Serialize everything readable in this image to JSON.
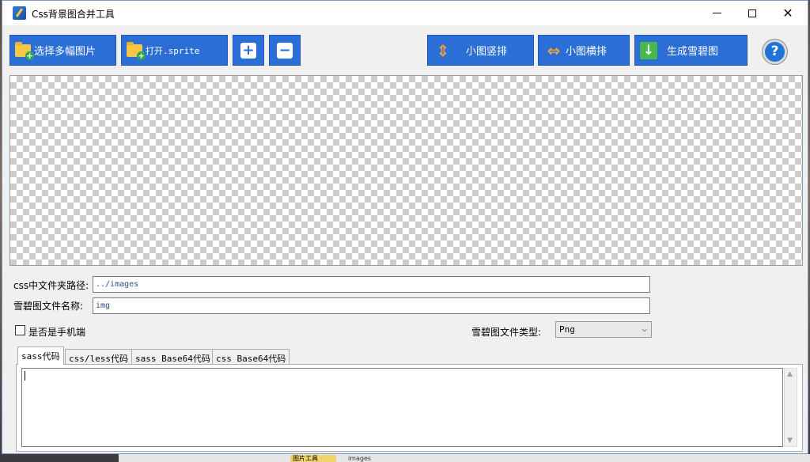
{
  "window": {
    "title": "Css背景图合并工具",
    "close_glyph": "✕"
  },
  "toolbar": {
    "select_images_label": "选择多幅图片",
    "open_sprite_label": "打开.sprite",
    "add_glyph": "+",
    "remove_glyph": "−",
    "vertical_label": "小图竖排",
    "horizontal_label": "小图横排",
    "generate_label": "生成雪碧图",
    "vertical_glyph": "⇕",
    "horizontal_glyph": "⇔",
    "generate_glyph": "↓",
    "help_glyph": "?"
  },
  "form": {
    "css_folder_label": "css中文件夹路径:",
    "css_folder_value": "../images",
    "sprite_name_label": "雪碧图文件名称:",
    "sprite_name_value": "img",
    "mobile_label": "是否是手机端",
    "file_type_label": "雪碧图文件类型:",
    "file_type_value": "Png",
    "select_chevron": "⌵"
  },
  "tabs": [
    {
      "label": "sass代码"
    },
    {
      "label": "css/less代码"
    },
    {
      "label": "sass Base64代码"
    },
    {
      "label": "css Base64代码"
    }
  ],
  "scroll": {
    "up": "▲",
    "down": "▼"
  },
  "background": {
    "tab_label": "图片工具",
    "tab_text": "images"
  },
  "colors": {
    "button_blue": "#2b6fd6",
    "arrow_orange": "#f2a13a",
    "generate_green": "#46b84e",
    "help_blue": "#1f74d8"
  }
}
